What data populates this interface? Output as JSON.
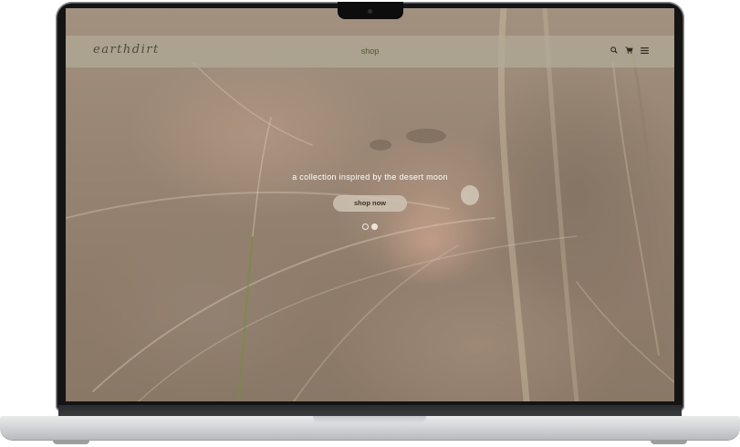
{
  "site": {
    "logo": "earthdirt",
    "nav_link": "shop",
    "icons": [
      "search-icon",
      "cart-icon",
      "menu-icon"
    ]
  },
  "hero": {
    "tagline": "a collection inspired by the desert moon",
    "cta_label": "shop now",
    "slides": {
      "count": 2,
      "active_index": 1
    }
  },
  "colors": {
    "nav_overlay": "#b2aa98",
    "nav_link": "#4e5a2e",
    "cta_bg": "#cec3b4",
    "tagline": "#ffffff"
  }
}
